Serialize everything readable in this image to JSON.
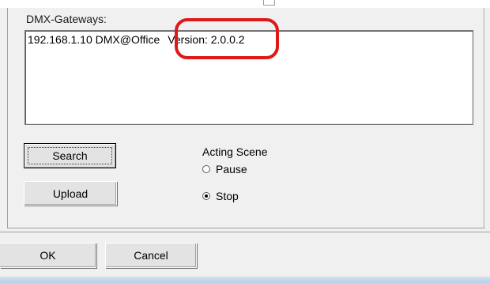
{
  "gateways": {
    "label": "DMX-Gateways:",
    "items": [
      {
        "name": "192.168.1.10 DMX@Office",
        "version": "Version: 2.0.0.2"
      }
    ]
  },
  "buttons": {
    "search": "Search",
    "upload": "Upload",
    "ok": "OK",
    "cancel": "Cancel"
  },
  "scene": {
    "label": "Acting Scene",
    "options": [
      {
        "label": "Pause",
        "checked": false
      },
      {
        "label": "Stop",
        "checked": true
      }
    ]
  },
  "colors": {
    "highlight": "#e01818",
    "dialog_bg": "#f0f0f0"
  }
}
